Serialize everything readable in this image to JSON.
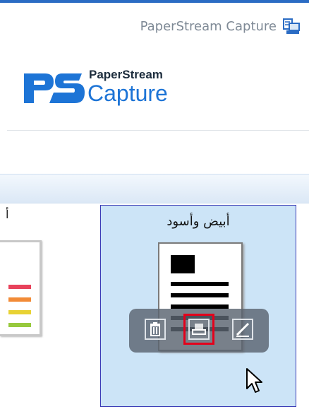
{
  "window": {
    "title": "PaperStream Capture",
    "app_icon": "scanner-app-icon"
  },
  "logo": {
    "line1": "PaperStream",
    "line2": "Capture",
    "brand_color": "#1d74d6"
  },
  "profiles": {
    "left_label": "أ",
    "selected_label": "أبيض وأسود",
    "selected_bg": "#cce4f7",
    "selected_border": "#3b3bb5"
  },
  "toolbar": {
    "buttons": [
      {
        "icon": "trash-icon",
        "name": "delete"
      },
      {
        "icon": "scan-icon",
        "name": "scan",
        "highlighted": true
      },
      {
        "icon": "edit-icon",
        "name": "edit"
      }
    ],
    "highlight_color": "#e4001b"
  },
  "left_swatches": [
    "#e8425b",
    "#f28b37",
    "#e8d234",
    "#97c93d"
  ]
}
